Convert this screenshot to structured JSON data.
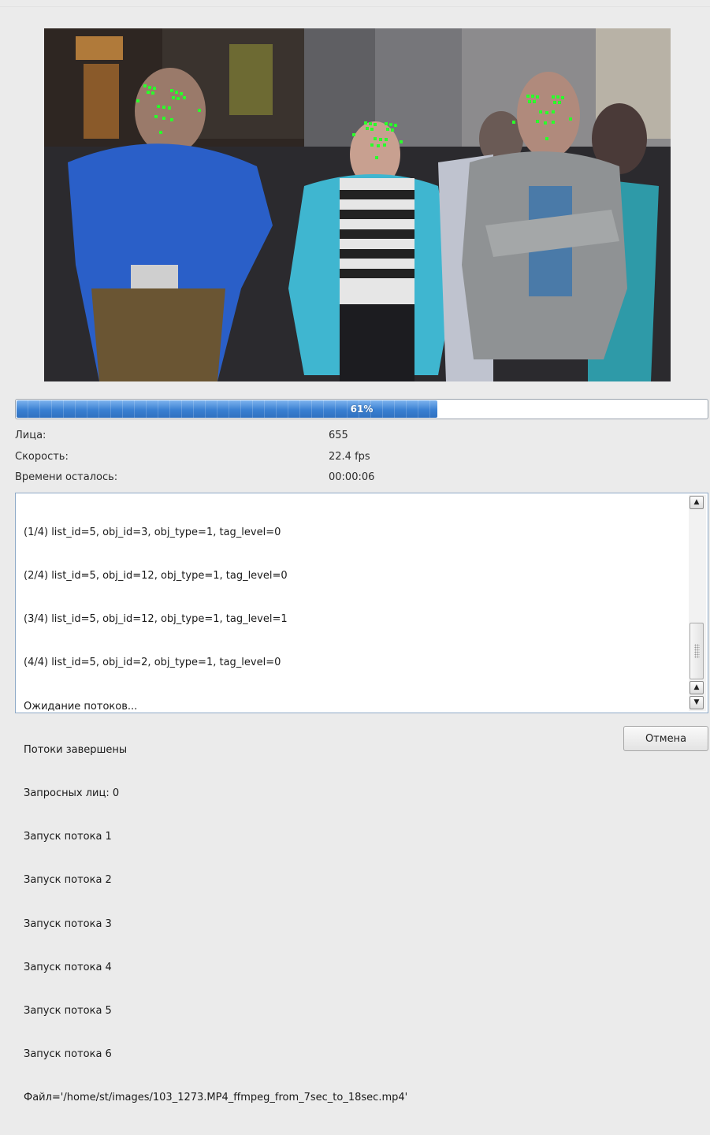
{
  "progress": {
    "percent": 61,
    "label": "61%"
  },
  "stats": [
    {
      "label": "Лица:",
      "value": "655"
    },
    {
      "label": "Скорость:",
      "value": "22.4 fps"
    },
    {
      "label": "Времени осталось:",
      "value": "00:00:06"
    }
  ],
  "log": {
    "lines": [
      "(1/4) list_id=5, obj_id=3, obj_type=1, tag_level=0",
      "(2/4) list_id=5, obj_id=12, obj_type=1, tag_level=0",
      "(3/4) list_id=5, obj_id=12, obj_type=1, tag_level=1",
      "(4/4) list_id=5, obj_id=2, obj_type=1, tag_level=0",
      "Ожидание потоков...",
      "Потоки завершены",
      "Запросных лиц: 0",
      "Запуск потока 1",
      "Запуск потока 2",
      "Запуск потока 3",
      "Запуск потока 4",
      "Запуск потока 5",
      "Запуск потока 6",
      "Файл='/home/st/images/103_1273.MP4_ffmpeg_from_7sec_to_18sec.mp4'"
    ]
  },
  "buttons": {
    "cancel": "Отмена"
  },
  "colors": {
    "progress_fill": "#3d86d6",
    "landmark": "#2bff2b",
    "log_border": "#8ea9c7"
  },
  "icons": {
    "scroll_up": "▲",
    "scroll_down": "▼"
  }
}
